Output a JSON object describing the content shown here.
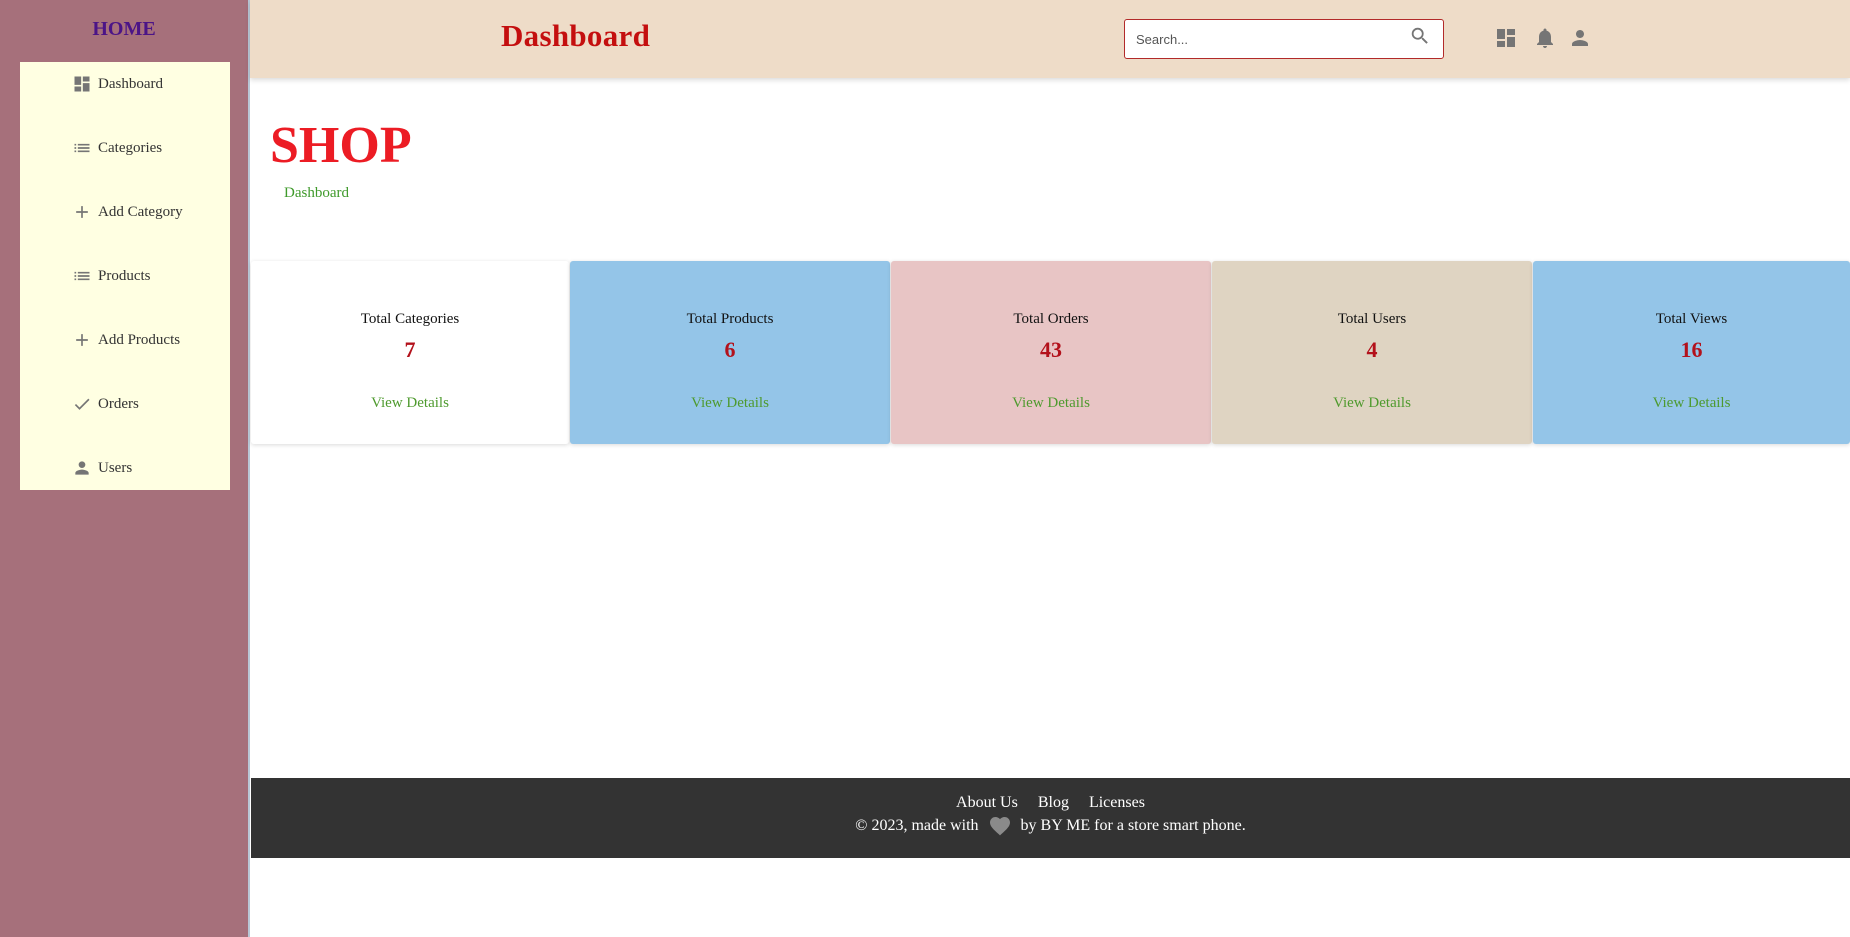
{
  "sidebar": {
    "home_label": "HOME",
    "items": [
      {
        "label": "Dashboard",
        "icon": "dashboard-icon"
      },
      {
        "label": "Categories",
        "icon": "list-icon"
      },
      {
        "label": "Add Category",
        "icon": "plus-icon"
      },
      {
        "label": "Products",
        "icon": "list-icon"
      },
      {
        "label": "Add Products",
        "icon": "plus-icon"
      },
      {
        "label": "Orders",
        "icon": "check-icon"
      },
      {
        "label": "Users",
        "icon": "person-icon"
      }
    ]
  },
  "header": {
    "title": "Dashboard",
    "search_placeholder": "Search...",
    "icons": [
      "dashboard-icon",
      "bell-icon",
      "person-icon"
    ]
  },
  "main": {
    "title": "SHOP",
    "breadcrumb": "Dashboard",
    "cards": [
      {
        "title": "Total Categories",
        "value": "7",
        "link": "View Details",
        "bg": "#ffffff"
      },
      {
        "title": "Total Products",
        "value": "6",
        "link": "View Details",
        "bg": "#94c5e8"
      },
      {
        "title": "Total Orders",
        "value": "43",
        "link": "View Details",
        "bg": "#e8c5c5"
      },
      {
        "title": "Total Users",
        "value": "4",
        "link": "View Details",
        "bg": "#dfd4c2"
      },
      {
        "title": "Total Views",
        "value": "16",
        "link": "View Details",
        "bg": "#94c5e8"
      }
    ]
  },
  "footer": {
    "links": [
      "About Us",
      "Blog",
      "Licenses"
    ],
    "copy_prefix": "© 2023, made with",
    "copy_suffix": "by BY ME for a store smart phone."
  },
  "colors": {
    "sidebar_bg": "#a6707b",
    "menu_bg": "#ffffe2",
    "header_bg": "#eedcc8",
    "accent_red": "#c40f0f",
    "link_green": "#4e9a2e",
    "footer_bg": "#333333"
  }
}
